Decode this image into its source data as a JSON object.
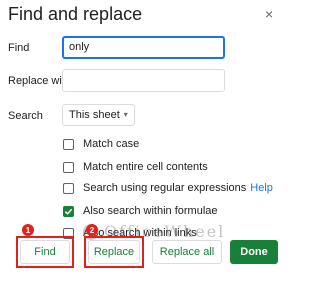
{
  "dialog": {
    "title": "Find and replace",
    "close_glyph": "×"
  },
  "fields": {
    "find_label": "Find",
    "find_value": "only",
    "replace_label": "Replace with",
    "replace_value": "",
    "search_label": "Search",
    "search_scope": "This sheet",
    "caret_glyph": "▾"
  },
  "options": [
    {
      "label": "Match case",
      "checked": false
    },
    {
      "label": "Match entire cell contents",
      "checked": false
    },
    {
      "label": "Search using regular expressions",
      "checked": false,
      "help": "Help"
    },
    {
      "label": "Also search within formulae",
      "checked": true
    },
    {
      "label": "Also search within links",
      "checked": false
    }
  ],
  "buttons": {
    "find": "Find",
    "replace": "Replace",
    "replace_all": "Replace all",
    "done": "Done"
  },
  "annotations": {
    "badge_1": "1",
    "badge_2": "2",
    "highlight_color": "#e0221f"
  },
  "watermark": {
    "text": "OfficeWheel"
  },
  "colors": {
    "accent_green": "#188038",
    "focus_blue": "#1a73e8",
    "link_blue": "#1a73e8"
  }
}
